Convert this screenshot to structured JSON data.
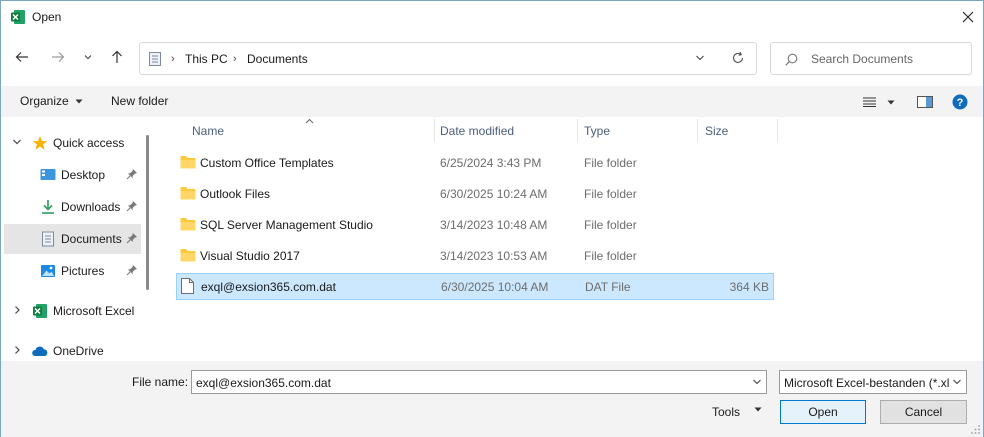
{
  "window": {
    "title": "Open"
  },
  "icons": {
    "app": "excel-icon",
    "close": "close-icon",
    "back": "back-arrow-icon",
    "forward": "forward-arrow-icon",
    "recent": "chevron-down-icon",
    "up": "up-arrow-icon",
    "refresh": "refresh-icon",
    "search": "search-icon",
    "folder": "folder-icon",
    "file": "file-icon",
    "pin": "pin-icon"
  },
  "colors": {
    "accent": "#0078d4",
    "selected_row": "#cce8ff",
    "folder": "#ffc83d",
    "excel": "#107c41",
    "star": "#f5b400",
    "onedrive": "#0f6cbd"
  },
  "address": {
    "crumbs": [
      "This PC",
      "Documents"
    ]
  },
  "search": {
    "placeholder": "Search Documents"
  },
  "toolbar": {
    "organize": "Organize",
    "new_folder": "New folder"
  },
  "sidebar": {
    "items": [
      {
        "label": "Quick access"
      },
      {
        "label": "Desktop"
      },
      {
        "label": "Downloads"
      },
      {
        "label": "Documents"
      },
      {
        "label": "Pictures"
      },
      {
        "label": "Microsoft Excel"
      },
      {
        "label": "OneDrive"
      }
    ]
  },
  "columns": [
    "Name",
    "Date modified",
    "Type",
    "Size"
  ],
  "files": [
    {
      "name": "Custom Office Templates",
      "date": "6/25/2024 3:43 PM",
      "type": "File folder",
      "size": ""
    },
    {
      "name": "Outlook Files",
      "date": "6/30/2025 10:24 AM",
      "type": "File folder",
      "size": ""
    },
    {
      "name": "SQL Server Management Studio",
      "date": "3/14/2023 10:48 AM",
      "type": "File folder",
      "size": ""
    },
    {
      "name": "Visual Studio 2017",
      "date": "3/14/2023 10:53 AM",
      "type": "File folder",
      "size": ""
    },
    {
      "name": "exql@exsion365.com.dat",
      "date": "6/30/2025 10:04 AM",
      "type": "DAT File",
      "size": "364 KB"
    }
  ],
  "bottom": {
    "file_name_label": "File name:",
    "file_name_value": "exql@exsion365.com.dat",
    "file_type": "Microsoft Excel-bestanden (*.xl",
    "tools": "Tools",
    "open": "Open",
    "cancel": "Cancel"
  }
}
